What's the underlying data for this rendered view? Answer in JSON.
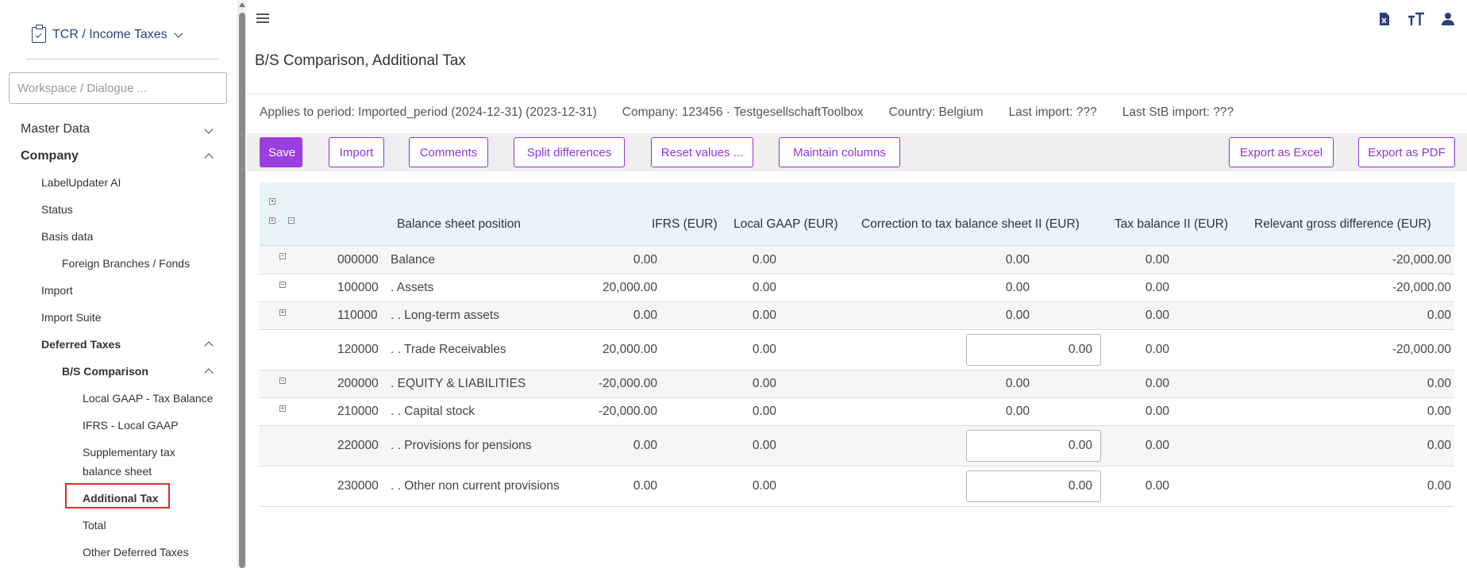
{
  "sidebar": {
    "app_title": "TCR / Income Taxes",
    "search_placeholder": "Workspace / Dialogue ...",
    "items": [
      {
        "label": "Master Data"
      },
      {
        "label": "Company"
      },
      {
        "label": "LabelUpdater AI"
      },
      {
        "label": "Status"
      },
      {
        "label": "Basis data"
      },
      {
        "label": "Foreign Branches / Fonds"
      },
      {
        "label": "Import"
      },
      {
        "label": "Import Suite"
      },
      {
        "label": "Deferred Taxes"
      },
      {
        "label": "B/S Comparison"
      },
      {
        "label": "Local GAAP - Tax Balance"
      },
      {
        "label": "IFRS - Local GAAP"
      },
      {
        "label": "Supplementary tax"
      },
      {
        "label": "balance sheet"
      },
      {
        "label": "Additional Tax"
      },
      {
        "label": "Total"
      },
      {
        "label": "Other Deferred Taxes"
      }
    ]
  },
  "header": {
    "title": "B/S Comparison, Additional Tax",
    "icons": [
      "excel-export-icon",
      "font-size-icon",
      "user-icon"
    ]
  },
  "info": {
    "period": "Applies to period: Imported_period (2024-12-31) (2023-12-31)",
    "company": "Company: 123456 · TestgesellschaftToolbox",
    "country": "Country: Belgium",
    "last_import": "Last import: ???",
    "last_stb_import": "Last StB import: ???"
  },
  "toolbar": {
    "save": "Save",
    "import": "Import",
    "comments": "Comments",
    "split": "Split differences",
    "reset": "Reset values ...",
    "maintain": "Maintain columns",
    "export_excel": "Export as Excel",
    "export_pdf": "Export as PDF"
  },
  "table": {
    "columns": {
      "position": "Balance sheet position",
      "ifrs": "IFRS (EUR)",
      "local": "Local GAAP (EUR)",
      "correction": "Correction to tax balance sheet II (EUR)",
      "tax": "Tax balance II (EUR)",
      "gross": "Relevant gross difference  (EUR)"
    },
    "rows": [
      {
        "code": "000000",
        "name": "Balance",
        "ifrs": "0.00",
        "local": "0.00",
        "correction": "0.00",
        "tax": "0.00",
        "gross": "-20,000.00"
      },
      {
        "code": "100000",
        "name": ". Assets",
        "ifrs": "20,000.00",
        "local": "0.00",
        "correction": "0.00",
        "tax": "0.00",
        "gross": "-20,000.00"
      },
      {
        "code": "110000",
        "name": ". . Long-term assets",
        "ifrs": "0.00",
        "local": "0.00",
        "correction": "0.00",
        "tax": "0.00",
        "gross": "0.00"
      },
      {
        "code": "120000",
        "name": ". . Trade Receivables",
        "ifrs": "20,000.00",
        "local": "0.00",
        "correction": "0.00",
        "tax": "0.00",
        "gross": "-20,000.00"
      },
      {
        "code": "200000",
        "name": ". EQUITY & LIABILITIES",
        "ifrs": "-20,000.00",
        "local": "0.00",
        "correction": "0.00",
        "tax": "0.00",
        "gross": "0.00"
      },
      {
        "code": "210000",
        "name": ". . Capital stock",
        "ifrs": "-20,000.00",
        "local": "0.00",
        "correction": "0.00",
        "tax": "0.00",
        "gross": "0.00"
      },
      {
        "code": "220000",
        "name": ". . Provisions for pensions",
        "ifrs": "0.00",
        "local": "0.00",
        "correction": "0.00",
        "tax": "0.00",
        "gross": "0.00"
      },
      {
        "code": "230000",
        "name": ". . Other non current provisions",
        "ifrs": "0.00",
        "local": "0.00",
        "correction": "0.00",
        "tax": "0.00",
        "gross": "0.00"
      }
    ]
  }
}
